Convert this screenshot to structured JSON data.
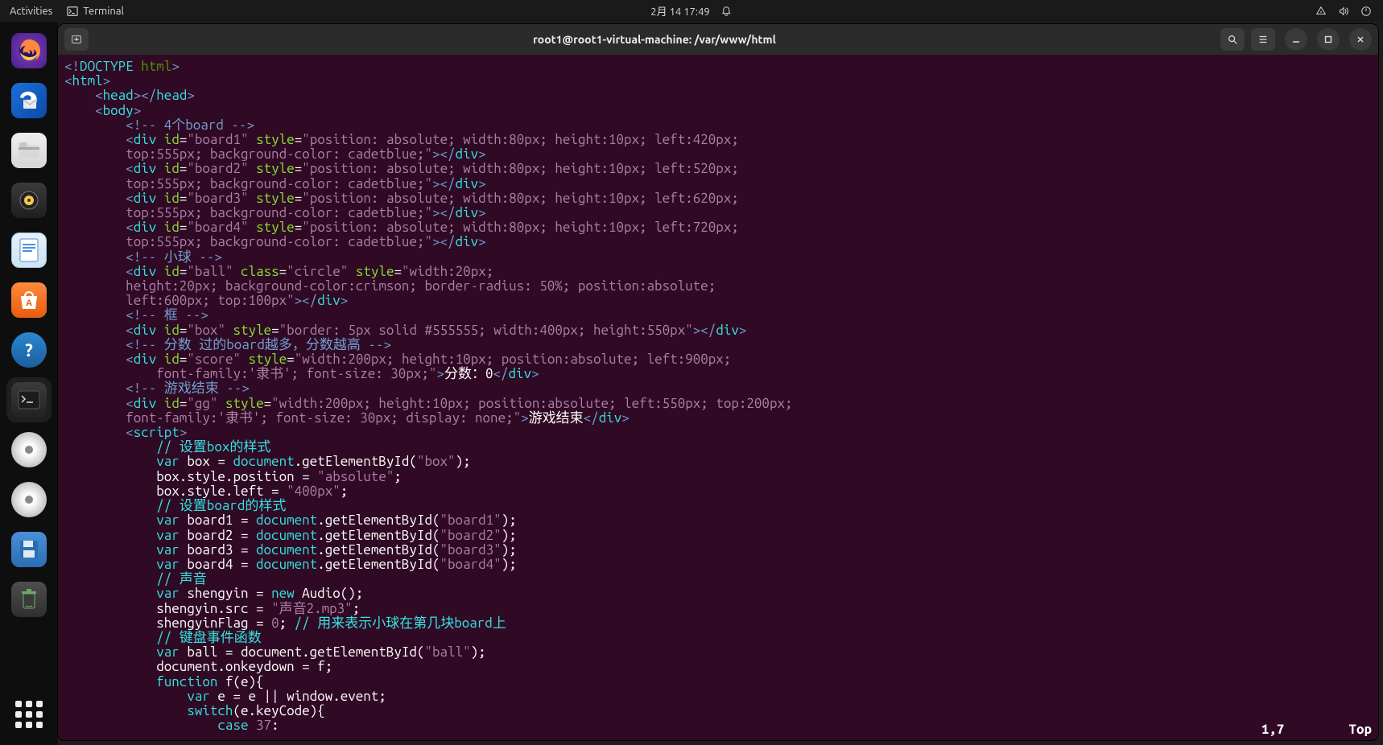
{
  "topbar": {
    "activities": "Activities",
    "app_name": "Terminal",
    "datetime": "2月 14  17:49"
  },
  "window": {
    "title": "root1@root1-virtual-machine: /var/www/html"
  },
  "status": {
    "pos": "1,7",
    "scroll": "Top"
  },
  "code": {
    "l1a": "<!",
    "l1b": "DOCTYPE ",
    "l1c": "html",
    "l1d": ">",
    "l2a": "<",
    "l2b": "html",
    "l2c": ">",
    "l3a": "<",
    "l3b": "head",
    "l3c": "></",
    "l3d": "head",
    "l3e": ">",
    "l4a": "<",
    "l4b": "body",
    "l4c": ">",
    "l5": "<!-- 4个board -->",
    "l6a": "<",
    "l6b": "div",
    "l6sp": " ",
    "l6c": "id",
    "l6d": "=",
    "l6e": "\"board1\"",
    "l6sp2": " ",
    "l6f": "style",
    "l6g": "=",
    "l6h": "\"position: absolute; width:80px; height:10px; left:420px;",
    "l7a": "top:555px; background-color: cadetblue;\"",
    "l7b": "></",
    "l7c": "div",
    "l7d": ">",
    "l8a": "<",
    "l8b": "div",
    "l8sp": " ",
    "l8c": "id",
    "l8d": "=",
    "l8e": "\"board2\"",
    "l8sp2": " ",
    "l8f": "style",
    "l8g": "=",
    "l8h": "\"position: absolute; width:80px; height:10px; left:520px;",
    "l9a": "top:555px; background-color: cadetblue;\"",
    "l9b": "></",
    "l9c": "div",
    "l9d": ">",
    "l10a": "<",
    "l10b": "div",
    "l10sp": " ",
    "l10c": "id",
    "l10d": "=",
    "l10e": "\"board3\"",
    "l10sp2": " ",
    "l10f": "style",
    "l10g": "=",
    "l10h": "\"position: absolute; width:80px; height:10px; left:620px;",
    "l11a": "top:555px; background-color: cadetblue;\"",
    "l11b": "></",
    "l11c": "div",
    "l11d": ">",
    "l12a": "<",
    "l12b": "div",
    "l12sp": " ",
    "l12c": "id",
    "l12d": "=",
    "l12e": "\"board4\"",
    "l12sp2": " ",
    "l12f": "style",
    "l12g": "=",
    "l12h": "\"position: absolute; width:80px; height:10px; left:720px;",
    "l13a": "top:555px; background-color: cadetblue;\"",
    "l13b": "></",
    "l13c": "div",
    "l13d": ">",
    "l14": "<!-- 小球 -->",
    "l15a": "<",
    "l15b": "div",
    "l15sp": " ",
    "l15c": "id",
    "l15d": "=",
    "l15e": "\"ball\"",
    "l15sp2": " ",
    "l15f": "class",
    "l15g": "=",
    "l15h": "\"circle\"",
    "l15sp3": " ",
    "l15i": "style",
    "l15j": "=",
    "l15k": "\"width:20px;",
    "l16": "height:20px; background-color:crimson; border-radius: 50%; position:absolute;",
    "l17a": "left:600px; top:100px\"",
    "l17b": "></",
    "l17c": "div",
    "l17d": ">",
    "l18": "<!-- 框 -->",
    "l19a": "<",
    "l19b": "div",
    "l19sp": " ",
    "l19c": "id",
    "l19d": "=",
    "l19e": "\"box\"",
    "l19sp2": " ",
    "l19f": "style",
    "l19g": "=",
    "l19h": "\"border: 5px solid #555555; width:400px; height:550px\"",
    "l19i": "></",
    "l19j": "div",
    "l19k": ">",
    "l20": "<!-- 分数 过的board越多，分数越高 -->",
    "l21a": "<",
    "l21b": "div",
    "l21sp": " ",
    "l21c": "id",
    "l21d": "=",
    "l21e": "\"score\"",
    "l21sp2": " ",
    "l21f": "style",
    "l21g": "=",
    "l21h": "\"width:200px; height:10px; position:absolute; left:900px;",
    "l22a": "    font-family:'隶书'; font-size: 30px;\"",
    "l22b": ">",
    "l22c": "分数：0",
    "l22d": "</",
    "l22e": "div",
    "l22f": ">",
    "l23": "<!-- 游戏结束 -->",
    "l24a": "<",
    "l24b": "div",
    "l24sp": " ",
    "l24c": "id",
    "l24d": "=",
    "l24e": "\"gg\"",
    "l24sp2": " ",
    "l24f": "style",
    "l24g": "=",
    "l24h": "\"width:200px; height:10px; position:absolute; left:550px; top:200px;",
    "l25a": "font-family:'隶书'; font-size: 30px; display: none;\"",
    "l25b": ">",
    "l25c": "游戏结束",
    "l25d": "</",
    "l25e": "div",
    "l25f": ">",
    "l26a": "<",
    "l26b": "script",
    "l26c": ">",
    "l27": "// 设置box的样式",
    "l28a": "var",
    "l28b": " box = ",
    "l28c": "document",
    "l28d": ".getElementById(",
    "l28e": "\"box\"",
    "l28f": ");",
    "l29a": "box.style.position = ",
    "l29b": "\"absolute\"",
    "l29c": ";",
    "l30a": "box.style.left = ",
    "l30b": "\"400px\"",
    "l30c": ";",
    "l31": "// 设置board的样式",
    "l32a": "var",
    "l32b": " board1 = ",
    "l32c": "document",
    "l32d": ".getElementById(",
    "l32e": "\"board1\"",
    "l32f": ");",
    "l33a": "var",
    "l33b": " board2 = ",
    "l33c": "document",
    "l33d": ".getElementById(",
    "l33e": "\"board2\"",
    "l33f": ");",
    "l34a": "var",
    "l34b": " board3 = ",
    "l34c": "document",
    "l34d": ".getElementById(",
    "l34e": "\"board3\"",
    "l34f": ");",
    "l35a": "var",
    "l35b": " board4 = ",
    "l35c": "document",
    "l35d": ".getElementById(",
    "l35e": "\"board4\"",
    "l35f": ");",
    "l36": "// 声音",
    "l37a": "var",
    "l37b": " shengyin = ",
    "l37c": "new",
    "l37d": " Audio();",
    "l38a": "shengyin.src = ",
    "l38b": "\"声音2.mp3\"",
    "l38c": ";",
    "l39a": "shengyinFlag = ",
    "l39b": "0",
    "l39c": "; ",
    "l39d": "// 用来表示小球在第几块board上",
    "l40": "// 键盘事件函数",
    "l41a": "var",
    "l41b": " ball = document.getElementById(",
    "l41c": "\"ball\"",
    "l41d": ");",
    "l42": "document.onkeydown = f;",
    "l43a": "function",
    "l43b": " f(e){",
    "l44a": "var",
    "l44b": " e = e || window.event;",
    "l45a": "switch",
    "l45b": "(e.keyCode){",
    "l46a": "case",
    "l46b": " ",
    "l46c": "37",
    "l46d": ":"
  }
}
